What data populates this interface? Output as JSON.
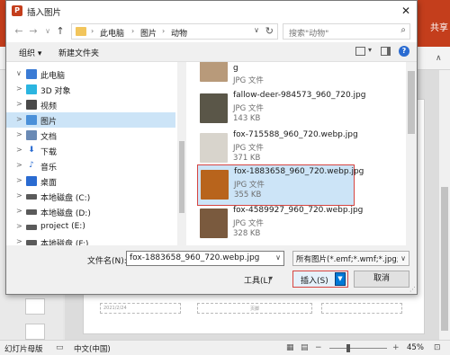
{
  "app": {
    "share_label": "共享"
  },
  "dialog": {
    "title": "插入图片",
    "nav": {
      "back_glyph": "←",
      "forward_glyph": "→",
      "recent_glyph": "∨",
      "up_glyph": "↑"
    },
    "breadcrumb": [
      "此电脑",
      "图片",
      "动物"
    ],
    "search_placeholder": "搜索\"动物\"",
    "toolbar": {
      "organize_label": "组织 ▾",
      "new_folder_label": "新建文件夹"
    },
    "nav_items": [
      {
        "label": "此电脑",
        "icon": "computer-icon",
        "color": "#3a7bd5",
        "chevron": "∨",
        "selected": false
      },
      {
        "label": "3D 对象",
        "icon": "cube-icon",
        "color": "#2bb5e0",
        "chevron": ">",
        "selected": false
      },
      {
        "label": "视频",
        "icon": "video-icon",
        "color": "#4a4a4a",
        "chevron": ">",
        "selected": false
      },
      {
        "label": "图片",
        "icon": "picture-icon",
        "color": "#4a90d9",
        "chevron": ">",
        "selected": true
      },
      {
        "label": "文档",
        "icon": "document-icon",
        "color": "#6a8ab5",
        "chevron": ">",
        "selected": false
      },
      {
        "label": "下载",
        "icon": "download-icon",
        "color": "#2a6bd1",
        "chevron": ">",
        "selected": false
      },
      {
        "label": "音乐",
        "icon": "music-icon",
        "color": "#2a6bd1",
        "chevron": ">",
        "selected": false
      },
      {
        "label": "桌面",
        "icon": "desktop-icon",
        "color": "#2a6bd1",
        "chevron": ">",
        "selected": false
      },
      {
        "label": "本地磁盘 (C:)",
        "icon": "drive-icon",
        "color": "#5a5a5a",
        "chevron": ">",
        "selected": false
      },
      {
        "label": "本地磁盘 (D:)",
        "icon": "drive-icon",
        "color": "#5a5a5a",
        "chevron": ">",
        "selected": false
      },
      {
        "label": "project (E:)",
        "icon": "drive-icon",
        "color": "#5a5a5a",
        "chevron": ">",
        "selected": false
      },
      {
        "label": "本地磁盘 (F:)",
        "icon": "drive-icon",
        "color": "#5a5a5a",
        "chevron": ">",
        "selected": false
      }
    ],
    "files": [
      {
        "name": "g",
        "type": "JPG 文件",
        "size": "",
        "thumb_color": "#b89a7a",
        "selected": false
      },
      {
        "name": "fallow-deer-984573_960_720.jpg",
        "type": "JPG 文件",
        "size": "143 KB",
        "thumb_color": "#5a5648",
        "selected": false
      },
      {
        "name": "fox-715588_960_720.webp.jpg",
        "type": "JPG 文件",
        "size": "371 KB",
        "thumb_color": "#d8d4cc",
        "selected": false
      },
      {
        "name": "fox-1883658_960_720.webp.jpg",
        "type": "JPG 文件",
        "size": "355 KB",
        "thumb_color": "#b8641c",
        "selected": true
      },
      {
        "name": "fox-4589927_960_720.webp.jpg",
        "type": "JPG 文件",
        "size": "328 KB",
        "thumb_color": "#7a5a3e",
        "selected": false
      }
    ],
    "filename_label": "文件名(N):",
    "filename_value": "fox-1883658_960_720.webp.jpg",
    "filter_value": "所有图片(*.emf;*.wmf;*.jpg;*.j",
    "tools_label": "工具(L)",
    "insert_label": "插入(S)",
    "cancel_label": "取消"
  },
  "slide": {
    "footer_left": "2021/2/24",
    "footer_center": "页脚"
  },
  "statusbar": {
    "mode": "幻灯片母版",
    "language": "中文(中国)",
    "zoom_out": "−",
    "zoom_in": "+",
    "zoom_percent": "45%",
    "zoom_fraction": 0.45
  },
  "colors": {
    "ppt_red": "#c43e1c",
    "selection_blue": "#cce4f7",
    "highlight_red": "#d64541",
    "accent_blue": "#0078d7"
  }
}
